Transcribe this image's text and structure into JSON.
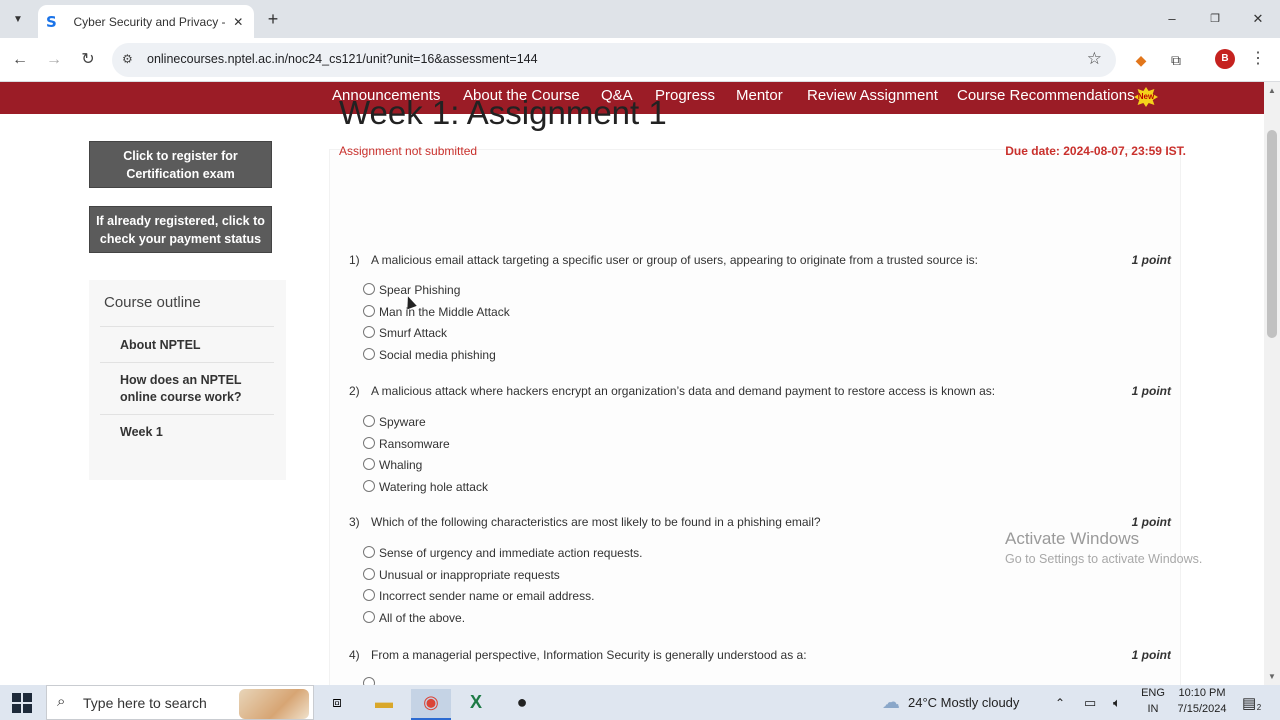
{
  "browser": {
    "tab_title": "Cyber Security and Privacy - - U",
    "tab_favicon": "S",
    "url": "onlinecourses.nptel.ac.in/noc24_cs121/unit?unit=16&assessment=144",
    "profile_initial": "B"
  },
  "course_nav": {
    "items": [
      "Announcements",
      "About the Course",
      "Q&A",
      "Progress",
      "Mentor",
      "Review Assignment",
      "Course Recommendations"
    ],
    "new_badge": "New"
  },
  "sidebar": {
    "register_button": "Click to register for Certification exam",
    "payment_button": "If already registered, click to check your payment status",
    "outline_title": "Course outline",
    "outline_items": [
      "About NPTEL",
      "How does an NPTEL online course work?",
      "Week 1"
    ]
  },
  "assignment": {
    "title": "Week 1: Assignment 1",
    "status": "Assignment not submitted",
    "due": "Due date: 2024-08-07, 23:59 IST.",
    "questions": [
      {
        "num": "1)",
        "text": "A malicious email attack targeting a specific user or group of users, appearing to originate from a trusted source is:",
        "points": "1 point",
        "options": [
          "Spear Phishing",
          "Man in the Middle Attack",
          "Smurf Attack",
          "Social media phishing"
        ]
      },
      {
        "num": "2)",
        "text": "A malicious attack where hackers encrypt an organization’s data and demand payment to restore access is known as:",
        "points": "1 point",
        "options": [
          "Spyware",
          "Ransomware",
          "Whaling",
          "Watering hole attack"
        ]
      },
      {
        "num": "3)",
        "text": "Which of the following characteristics are most likely to be found in a phishing email?",
        "points": "1 point",
        "options": [
          "Sense of urgency and immediate action requests.",
          "Unusual or inappropriate requests",
          "Incorrect sender name or email address.",
          "All of the above."
        ]
      },
      {
        "num": "4)",
        "text": "From a managerial perspective, Information Security is generally understood as a:",
        "points": "1 point",
        "options": []
      }
    ]
  },
  "watermark": {
    "line1": "Activate Windows",
    "line2": "Go to Settings to activate Windows."
  },
  "taskbar": {
    "search_placeholder": "Type here to search",
    "weather": "24°C  Mostly cloudy",
    "lang1": "ENG",
    "lang2": "IN",
    "time": "10:10 PM",
    "date": "7/15/2024",
    "notifications": "2"
  }
}
